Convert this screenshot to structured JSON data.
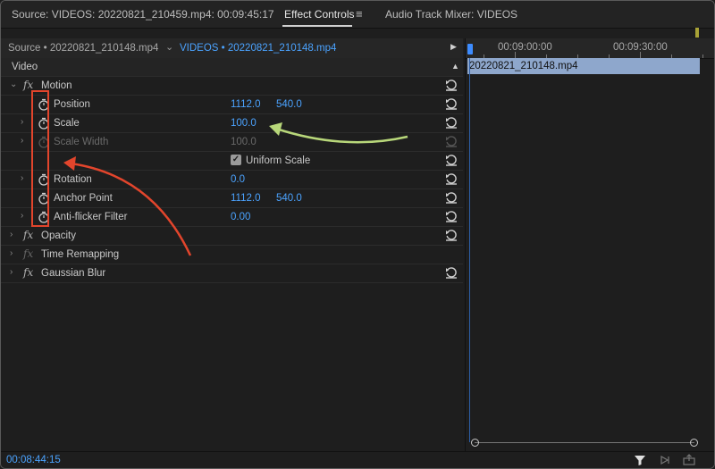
{
  "top_tabs": {
    "source": "Source: VIDEOS: 20220821_210459.mp4: 00:09:45:17",
    "effect_controls": "Effect Controls",
    "audio_mixer": "Audio Track Mixer: VIDEOS"
  },
  "sub_tabs": {
    "source_clip": "Source • 20220821_210148.mp4",
    "sequence_clip": "VIDEOS • 20220821_210148.mp4"
  },
  "section_header": "Video",
  "effects": {
    "motion": "Motion",
    "position_label": "Position",
    "position_x": "1112.0",
    "position_y": "540.0",
    "scale_label": "Scale",
    "scale_value": "100.0",
    "scale_width_label": "Scale Width",
    "scale_width_value": "100.0",
    "uniform_scale_label": "Uniform Scale",
    "uniform_scale_checked": true,
    "rotation_label": "Rotation",
    "rotation_value": "0.0",
    "anchor_label": "Anchor Point",
    "anchor_x": "1112.0",
    "anchor_y": "540.0",
    "antiflicker_label": "Anti-flicker Filter",
    "antiflicker_value": "0.00",
    "opacity": "Opacity",
    "time_remapping": "Time Remapping",
    "gaussian_blur": "Gaussian Blur"
  },
  "timeline": {
    "ruler_start": "00:09:00:00",
    "ruler_next": "00:09:30:00",
    "clip_name": "20220821_210148.mp4"
  },
  "status": {
    "timecode": "00:08:44:15"
  },
  "icons": [
    "stopwatch-icon",
    "reset-icon",
    "fx-icon",
    "filter-icon",
    "play-icon",
    "export-icon"
  ],
  "colors": {
    "accent_blue": "#4ba3ff",
    "clip_blue": "#8ea7cc",
    "annotation_red": "#e2452c",
    "annotation_green": "#b8d77a"
  }
}
